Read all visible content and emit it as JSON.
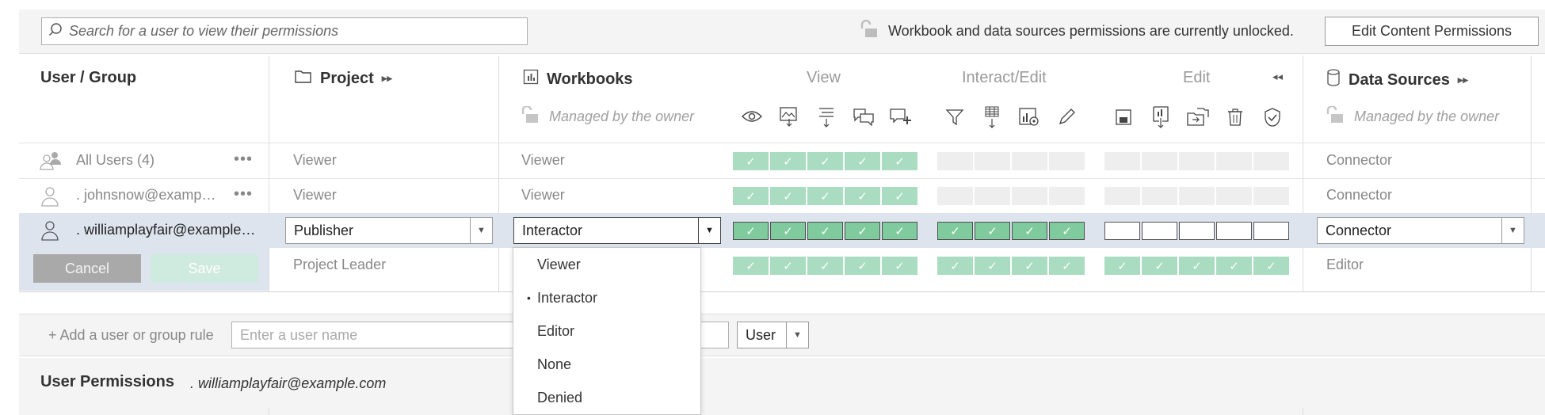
{
  "search": {
    "placeholder": "Search for a user to view their permissions"
  },
  "lock_message": "Workbook and data sources permissions are currently unlocked.",
  "edit_content_button": "Edit Content Permissions",
  "columns": {
    "user_group": "User / Group",
    "project": "Project",
    "workbooks": "Workbooks",
    "data_sources": "Data Sources",
    "groups": {
      "view": "View",
      "interact_edit": "Interact/Edit",
      "edit": "Edit"
    },
    "workbooks_managed": "Managed by the owner",
    "data_sources_managed": "Managed by the owner"
  },
  "capability_icons": {
    "view": [
      "eye-icon",
      "download-image-icon",
      "download-summary-data-icon",
      "view-comments-icon",
      "add-comment-icon"
    ],
    "interact_edit": [
      "filter-icon",
      "download-full-data-icon",
      "web-edit-icon",
      "edit-pencil-icon"
    ],
    "edit": [
      "save-icon",
      "download-workbook-icon",
      "move-icon",
      "delete-icon",
      "set-permissions-icon"
    ]
  },
  "rows": [
    {
      "user": "All Users (4)",
      "project": "Viewer",
      "workbook": "Viewer",
      "data_source": "Connector",
      "view": [
        true,
        true,
        true,
        true,
        true
      ],
      "interact": [
        false,
        false,
        false,
        false
      ],
      "edit": [
        false,
        false,
        false,
        false,
        false
      ]
    },
    {
      "user": ". johnsnow@examp…",
      "project": "Viewer",
      "workbook": "Viewer",
      "data_source": "Connector",
      "view": [
        true,
        true,
        true,
        true,
        true
      ],
      "interact": [
        false,
        false,
        false,
        false
      ],
      "edit": [
        false,
        false,
        false,
        false,
        false
      ]
    },
    {
      "user": ". williamplayfair@example…",
      "project": "Publisher",
      "workbook": "Interactor",
      "data_source": "Connector",
      "view": [
        true,
        true,
        true,
        true,
        true
      ],
      "interact": [
        true,
        true,
        true,
        true
      ],
      "edit": [
        false,
        false,
        false,
        false,
        false
      ]
    },
    {
      "user": "",
      "project": "Project Leader",
      "workbook": "",
      "data_source": "Editor",
      "view": [
        true,
        true,
        true,
        true,
        true
      ],
      "interact": [
        true,
        true,
        true,
        true
      ],
      "edit": [
        true,
        true,
        true,
        true,
        true
      ]
    }
  ],
  "buttons": {
    "cancel": "Cancel",
    "save": "Save"
  },
  "workbook_menu": {
    "options": [
      "Viewer",
      "Interactor",
      "Editor",
      "None",
      "Denied"
    ],
    "selected": "Interactor",
    "bullet": "•"
  },
  "add_rule": {
    "label": "+ Add a user or group rule",
    "placeholder": "Enter a user name",
    "type_value": "User"
  },
  "user_permissions": {
    "title": "User Permissions",
    "user": ". williamplayfair@example.com"
  },
  "colors": {
    "allowed": "#7fcb9d",
    "allowed_inherited": "#a9dcc0",
    "selected_row": "#dde4ee",
    "unset": "#eeeeee"
  }
}
